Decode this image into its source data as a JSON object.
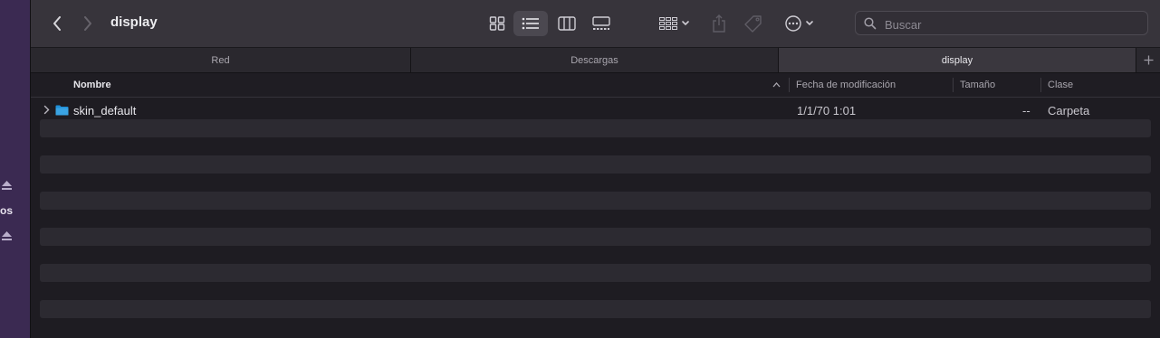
{
  "sidebar": {
    "partial_label": "os"
  },
  "toolbar": {
    "title": "display",
    "search_placeholder": "Buscar",
    "views": [
      "icon-view-icon",
      "list-view-icon",
      "column-view-icon",
      "gallery-view-icon"
    ],
    "active_view": "list-view-icon"
  },
  "tabs": [
    {
      "label": "Red",
      "active": false
    },
    {
      "label": "Descargas",
      "active": false
    },
    {
      "label": "display",
      "active": true
    }
  ],
  "columns": {
    "name": "Nombre",
    "date": "Fecha de modificación",
    "size": "Tamaño",
    "kind": "Clase"
  },
  "files": [
    {
      "name": "skin_default",
      "date": "1/1/70 1:01",
      "size": "--",
      "kind": "Carpeta",
      "type": "folder"
    }
  ],
  "colors": {
    "accent_folder": "#3aa3e3",
    "sidebar": "#3b2a52"
  }
}
